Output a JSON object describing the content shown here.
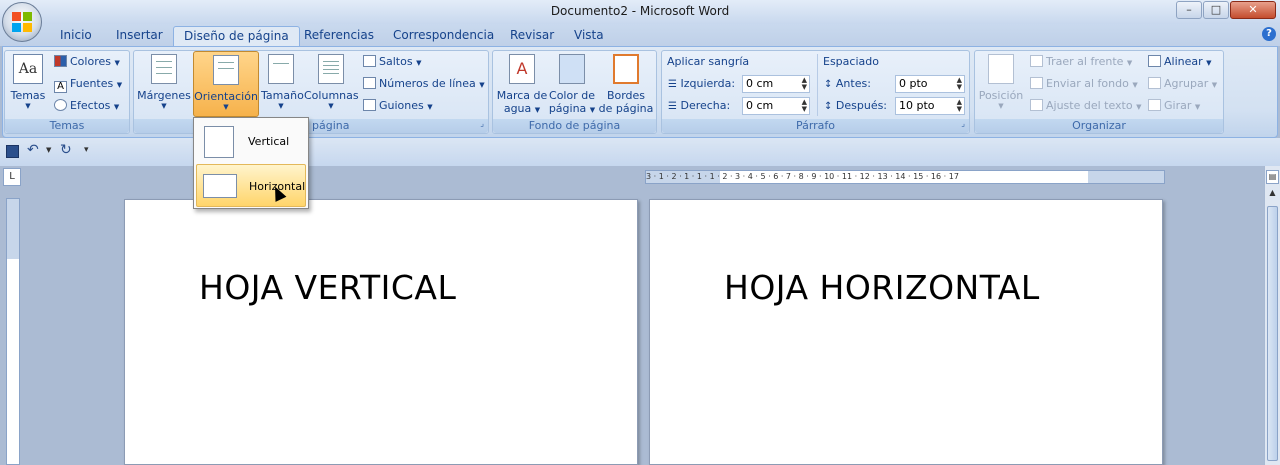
{
  "window": {
    "title": "Documento2 - Microsoft Word",
    "min": "–",
    "max": "□",
    "close": "✕"
  },
  "tabs": [
    "Inicio",
    "Insertar",
    "Diseño de página",
    "Referencias",
    "Correspondencia",
    "Revisar",
    "Vista"
  ],
  "active_tab": "Diseño de página",
  "ribbon": {
    "temas": {
      "caption": "Temas",
      "temas_btn": "Temas",
      "colores": "Colores",
      "fuentes": "Fuentes",
      "efectos": "Efectos"
    },
    "configurar": {
      "caption": "página",
      "margenes": "Márgenes",
      "orientacion": "Orientación",
      "tamano": "Tamaño",
      "columnas": "Columnas",
      "saltos": "Saltos",
      "numeros": "Números de línea",
      "guiones": "Guiones"
    },
    "fondo": {
      "caption": "Fondo de página",
      "marca_1": "Marca de",
      "marca_2": "agua",
      "color_1": "Color de",
      "color_2": "página",
      "bordes_1": "Bordes",
      "bordes_2": "de página"
    },
    "parrafo": {
      "caption": "Párrafo",
      "sangria": "Aplicar sangría",
      "izquierda": "Izquierda:",
      "izquierda_val": "0 cm",
      "derecha": "Derecha:",
      "derecha_val": "0 cm",
      "espaciado": "Espaciado",
      "antes": "Antes:",
      "antes_val": "0 pto",
      "despues": "Después:",
      "despues_val": "10 pto"
    },
    "organizar": {
      "caption": "Organizar",
      "posicion": "Posición",
      "traer": "Traer al frente",
      "enviar": "Enviar al fondo",
      "ajuste": "Ajuste del texto",
      "alinear": "Alinear",
      "agrupar": "Agrupar",
      "girar": "Girar"
    }
  },
  "orientation_menu": {
    "vertical": "Vertical",
    "horizontal": "Horizontal"
  },
  "ruler": {
    "numbers": "3 · 1 · 2 · 1 · 1 · 1 · 2 · 3 · 4 · 5 · 6 · 7 · 8 · 9 · 10 · 11 · 12 · 13 · 14 · 15 · 16 · 17"
  },
  "pages": {
    "left": "HOJA VERTICAL",
    "right": "HOJA HORIZONTAL"
  },
  "colors": {
    "ribbon_text": "#15428b",
    "highlight": "#ffd56b"
  }
}
